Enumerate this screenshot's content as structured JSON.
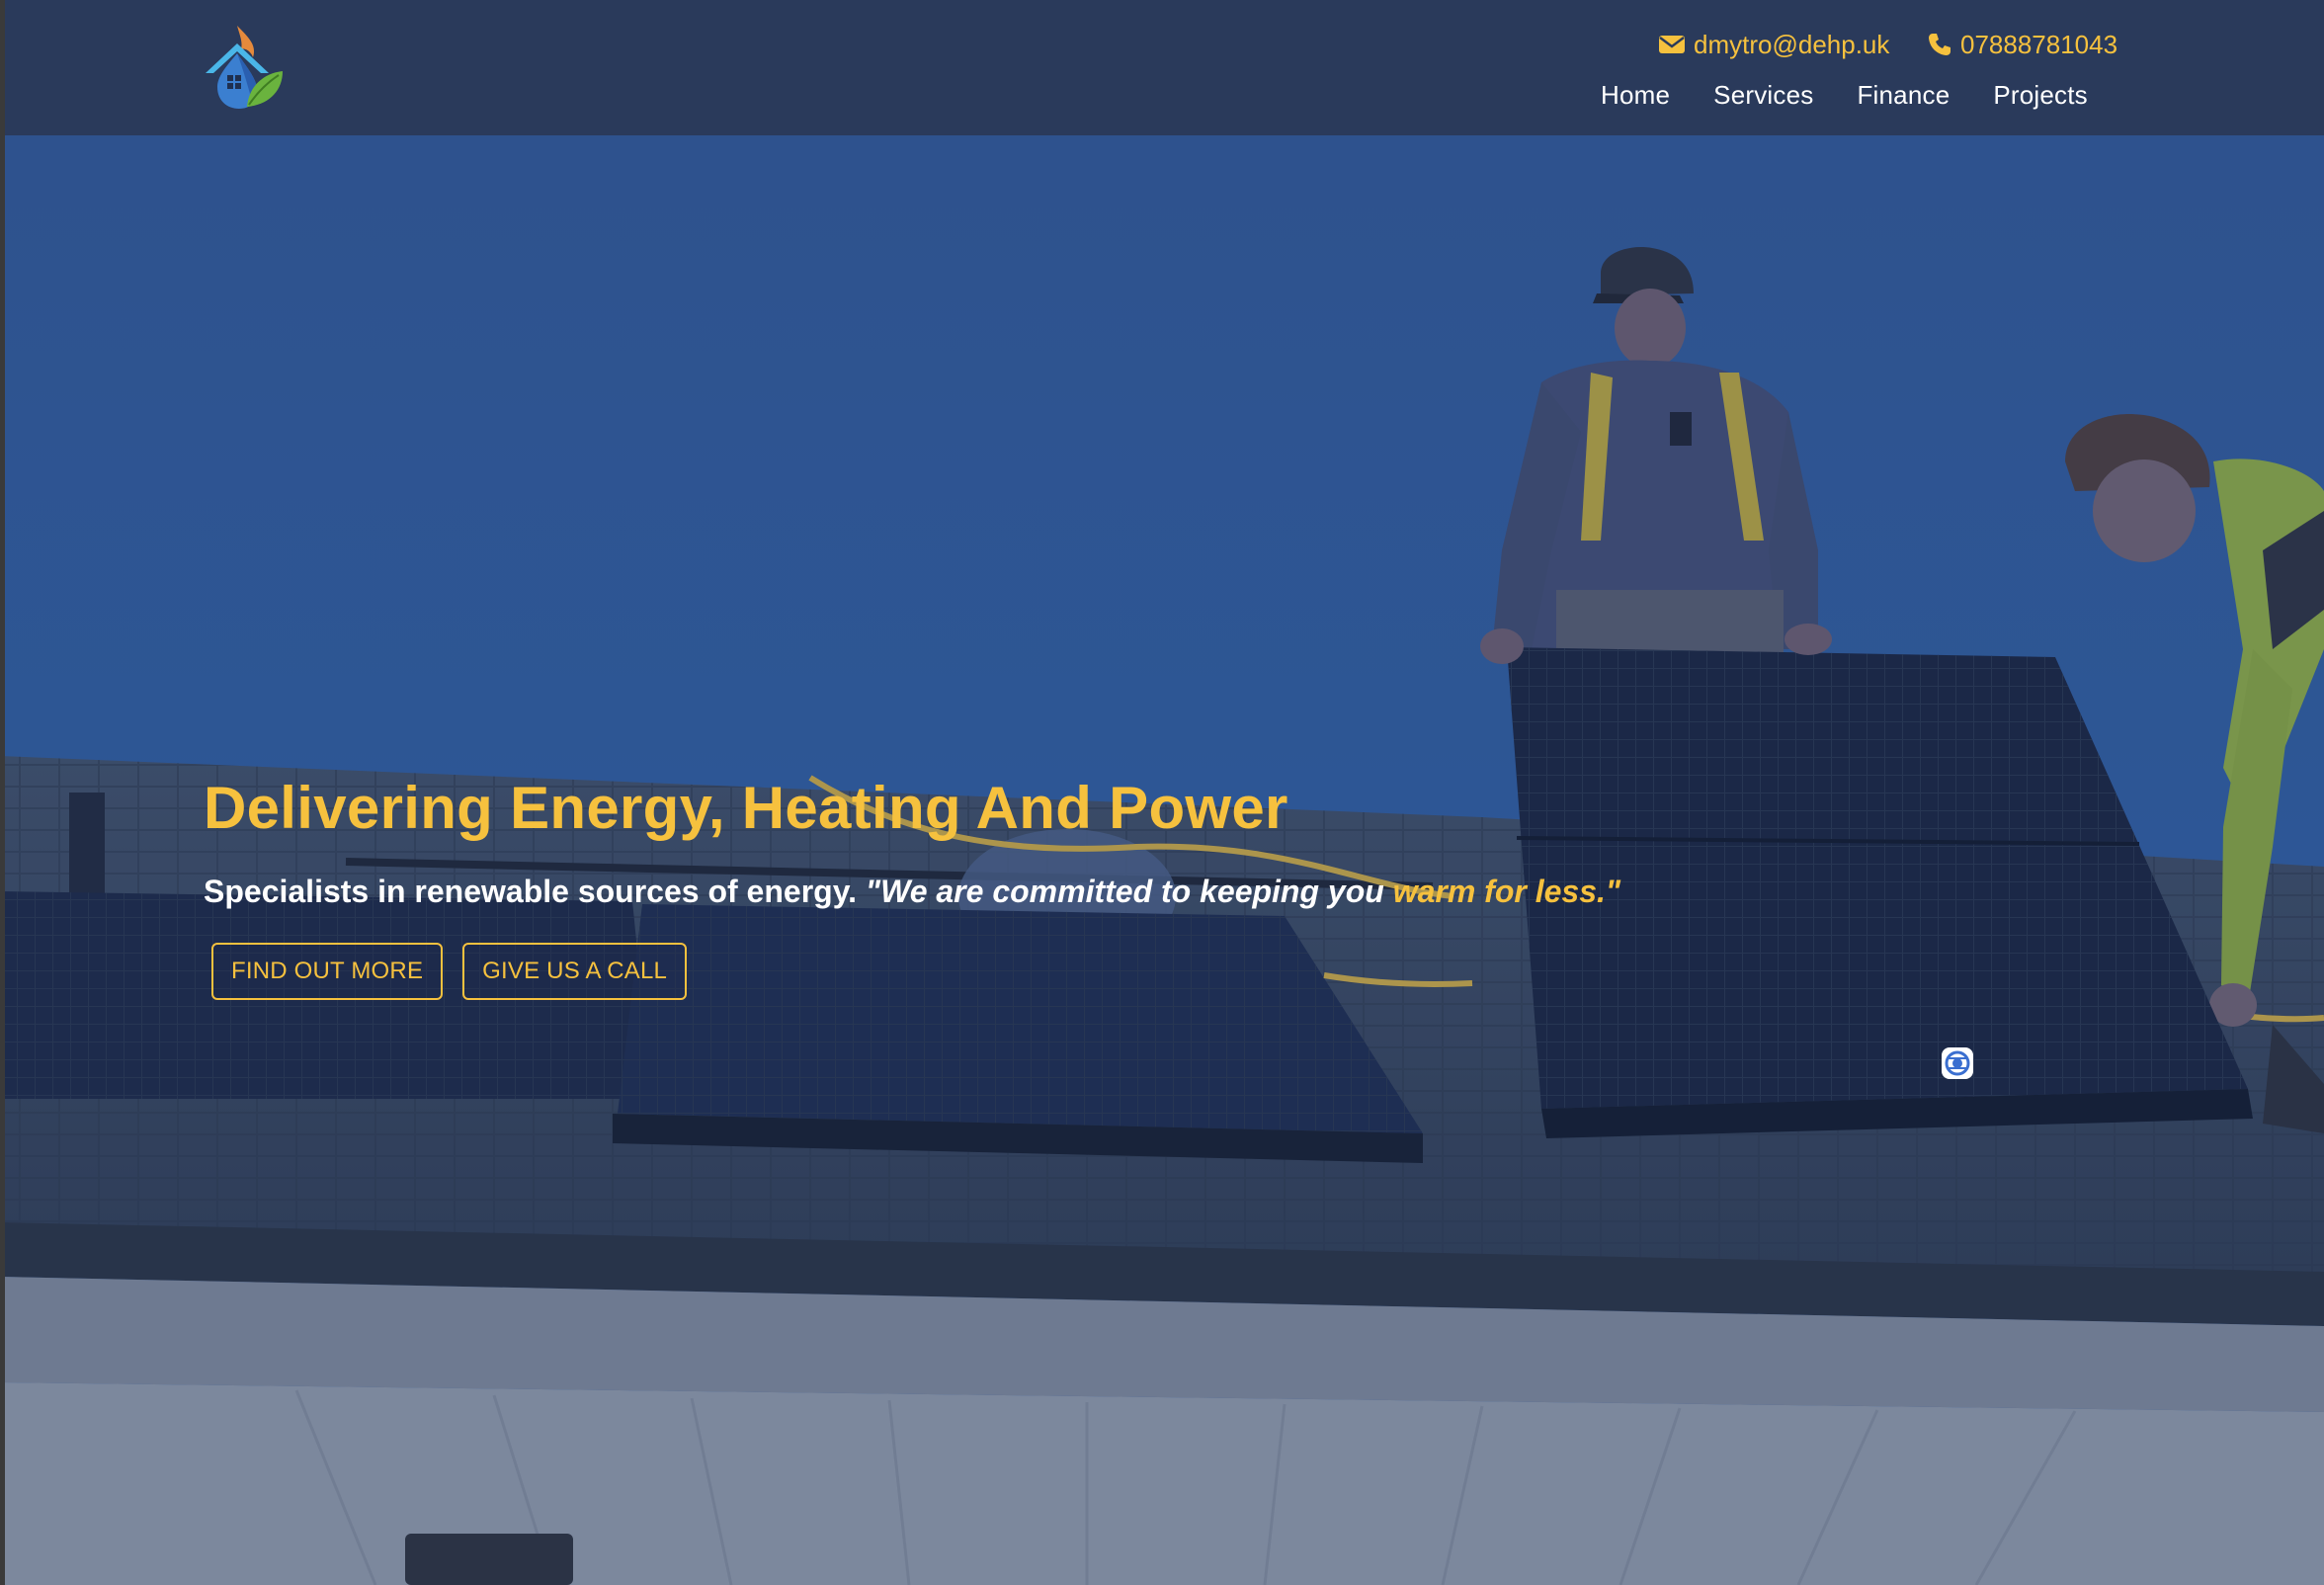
{
  "header": {
    "contact": {
      "email": "dmytro@dehp.uk",
      "phone": "07888781043"
    },
    "nav": [
      {
        "label": "Home"
      },
      {
        "label": "Services"
      },
      {
        "label": "Finance"
      },
      {
        "label": "Projects"
      }
    ]
  },
  "hero": {
    "title": "Delivering Energy, Heating And Power",
    "subtitle": "Specialists in renewable sources of energy.",
    "quote_start": "\"We are committed to keeping you ",
    "quote_highlight": "warm for less.\"",
    "buttons": {
      "primary": "FIND OUT MORE",
      "secondary": "GIVE US A CALL"
    }
  },
  "icons": {
    "logo": "house-flame-leaf-logo",
    "email": "envelope-icon",
    "phone": "phone-icon",
    "widget": "chat-widget-icon"
  },
  "colors": {
    "accent": "#f6c13e",
    "header_bg": "#2a3a5b",
    "hero_overlay": "#2b4a86",
    "nav_text": "#ffffff"
  }
}
